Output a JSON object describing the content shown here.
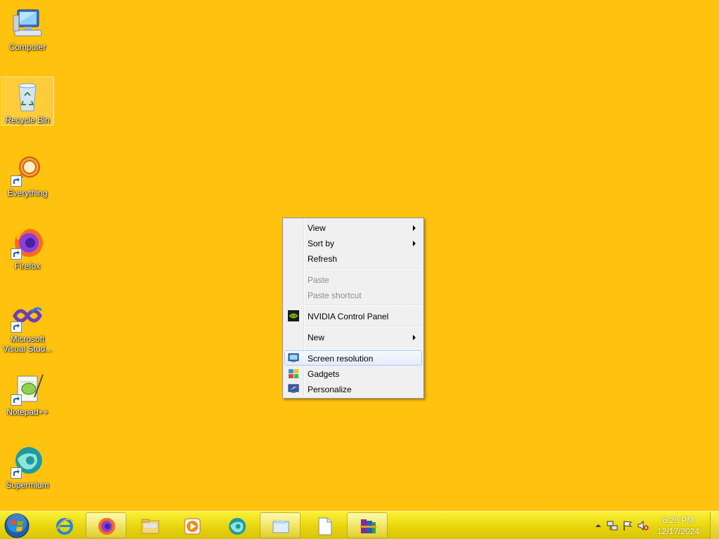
{
  "desktop": {
    "background_color": "#FFC20E",
    "icons": [
      {
        "label": "Computer",
        "icon": "computer-icon",
        "shortcut": false,
        "selected": false
      },
      {
        "label": "Recycle Bin",
        "icon": "recycle-bin-icon",
        "shortcut": false,
        "selected": true
      },
      {
        "label": "Everything",
        "icon": "everything-search-icon",
        "shortcut": true,
        "selected": false
      },
      {
        "label": "Firefox",
        "icon": "firefox-icon",
        "shortcut": true,
        "selected": false
      },
      {
        "label": "Microsoft Visual Stud...",
        "label_line1": "Microsoft",
        "label_line2": "Visual Stud...",
        "icon": "visual-studio-icon",
        "shortcut": true,
        "selected": false
      },
      {
        "label": "Notepad++",
        "icon": "notepad-plus-plus-icon",
        "shortcut": true,
        "selected": false
      },
      {
        "label": "Supermium",
        "icon": "supermium-icon",
        "shortcut": true,
        "selected": false
      }
    ]
  },
  "context_menu": {
    "items": [
      {
        "label": "View",
        "submenu": true,
        "enabled": true
      },
      {
        "label": "Sort by",
        "submenu": true,
        "enabled": true
      },
      {
        "label": "Refresh",
        "enabled": true
      },
      {
        "label": "Paste",
        "enabled": false
      },
      {
        "label": "Paste shortcut",
        "enabled": false
      },
      {
        "label": "NVIDIA Control Panel",
        "icon": "nvidia-icon",
        "enabled": true
      },
      {
        "label": "New",
        "submenu": true,
        "enabled": true
      },
      {
        "label": "Screen resolution",
        "icon": "display-icon",
        "enabled": true,
        "highlighted": true
      },
      {
        "label": "Gadgets",
        "icon": "gadgets-icon",
        "enabled": true
      },
      {
        "label": "Personalize",
        "icon": "personalize-icon",
        "enabled": true
      }
    ]
  },
  "taskbar": {
    "start_icon": "windows-start-icon",
    "pinned": [
      {
        "icon": "internet-explorer-icon",
        "active": false
      },
      {
        "icon": "firefox-icon",
        "active": true
      },
      {
        "icon": "file-explorer-icon",
        "active": false
      },
      {
        "icon": "media-player-icon",
        "active": false
      },
      {
        "icon": "supermium-icon",
        "active": false
      },
      {
        "icon": "folder-window-icon",
        "active": true
      },
      {
        "icon": "blank-document-icon",
        "active": false
      },
      {
        "icon": "winrar-icon",
        "active": true
      }
    ],
    "tray": {
      "icons": [
        "show-hidden-icons-arrow",
        "network-icon",
        "action-center-flag-icon",
        "volume-muted-icon"
      ],
      "time": "8:28 PM",
      "date": "12/17/2024"
    }
  }
}
